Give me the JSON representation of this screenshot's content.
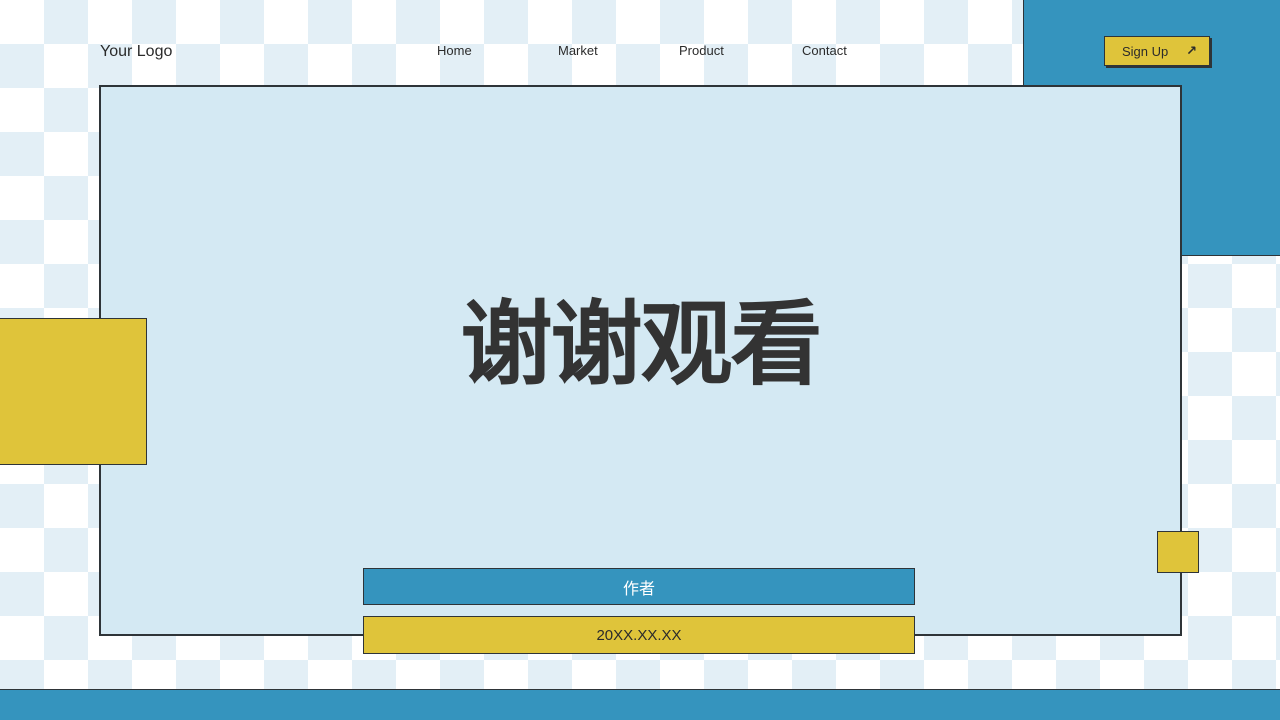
{
  "header": {
    "logo": "Your Logo",
    "nav": [
      "Home",
      "Market",
      "Product",
      "Contact"
    ],
    "signup_label": "Sign Up",
    "signup_icon": "↗"
  },
  "main": {
    "title": "谢谢观看",
    "author": "作者",
    "date": "20XX.XX.XX"
  },
  "colors": {
    "blue": "#3594be",
    "yellow": "#dfc43a",
    "light_blue": "#d4e9f3",
    "dark": "#2e3438"
  }
}
